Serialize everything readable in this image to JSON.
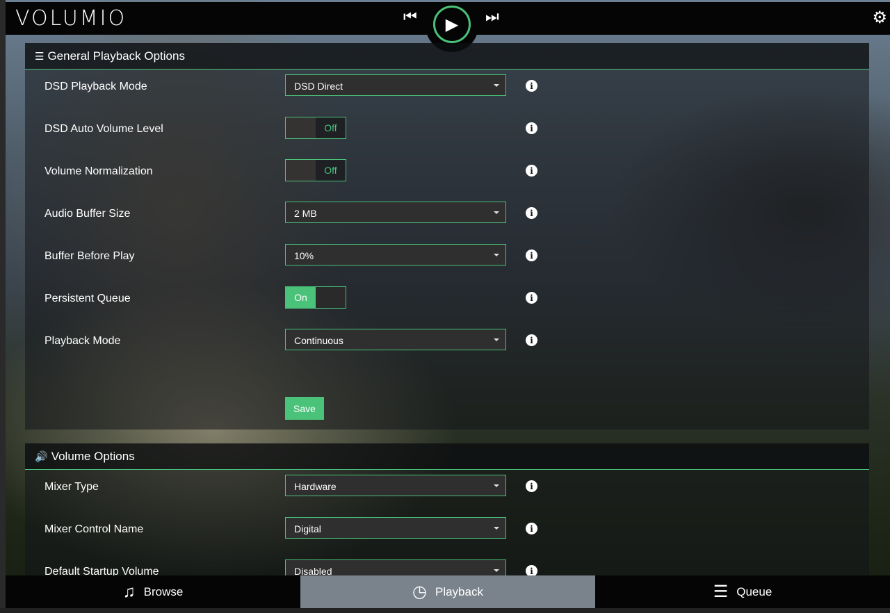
{
  "header": {
    "logo": "VOLUMIO",
    "prev_icon": "skip-previous-icon",
    "play_icon": "play-icon",
    "next_icon": "skip-next-icon",
    "settings_icon": "gear-icon"
  },
  "accent": "#4bc27a",
  "general": {
    "title": "General Playback Options",
    "rows": [
      {
        "label": "DSD Playback Mode",
        "type": "select",
        "value": "DSD Direct"
      },
      {
        "label": "DSD Auto Volume Level",
        "type": "toggle",
        "value": "Off"
      },
      {
        "label": "Volume Normalization",
        "type": "toggle",
        "value": "Off"
      },
      {
        "label": "Audio Buffer Size",
        "type": "select",
        "value": "2 MB"
      },
      {
        "label": "Buffer Before Play",
        "type": "select",
        "value": "10%"
      },
      {
        "label": "Persistent Queue",
        "type": "toggle",
        "value": "On"
      },
      {
        "label": "Playback Mode",
        "type": "select",
        "value": "Continuous"
      }
    ],
    "save_label": "Save"
  },
  "volume": {
    "title": "Volume Options",
    "rows": [
      {
        "label": "Mixer Type",
        "type": "select",
        "value": "Hardware"
      },
      {
        "label": "Mixer Control Name",
        "type": "select",
        "value": "Digital"
      },
      {
        "label": "Default Startup Volume",
        "type": "select",
        "value": "Disabled"
      }
    ]
  },
  "nav": {
    "tabs": [
      {
        "label": "Browse",
        "icon": "music-note-icon"
      },
      {
        "label": "Playback",
        "icon": "clock-icon",
        "active": true
      },
      {
        "label": "Queue",
        "icon": "list-icon"
      }
    ]
  }
}
